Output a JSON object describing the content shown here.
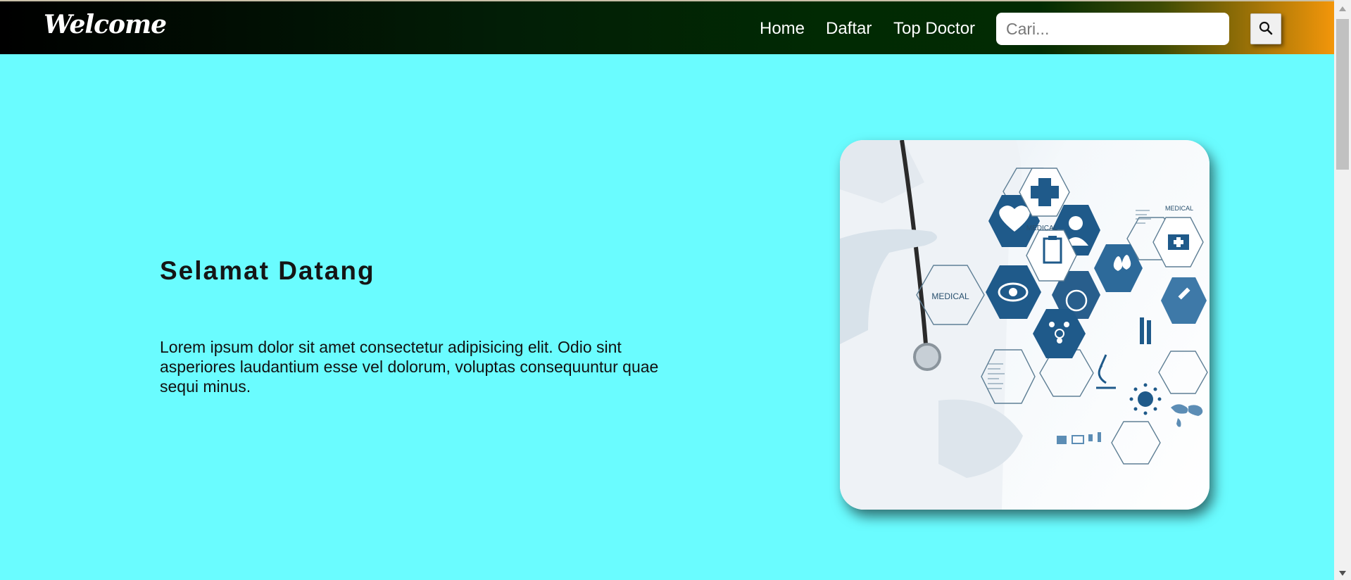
{
  "navbar": {
    "brand": "Welcome",
    "links": [
      {
        "label": "Home"
      },
      {
        "label": "Daftar"
      },
      {
        "label": "Top Doctor"
      }
    ],
    "search": {
      "placeholder": "Cari...",
      "value": "",
      "button_icon": "search-icon"
    }
  },
  "hero": {
    "title": "Selamat Datang",
    "text": "Lorem ipsum dolor sit amet consectetur adipisicing elit. Odio sint asperiores laudantium esse vel dolorum, voluptas consequuntur quae sequi minus.",
    "image": {
      "hex_labels": [
        "MEDICAL",
        "MEDICAL",
        "MEDICAL"
      ],
      "icons": [
        "heart-icon",
        "cross-icon",
        "person-icon",
        "clipboard-icon",
        "eye-icon",
        "drops-icon",
        "wheelchair-icon",
        "molecule-icon",
        "test-tubes-icon",
        "microscope-icon",
        "syringe-icon",
        "medical-bag-icon",
        "virus-icon",
        "world-map-icon"
      ]
    }
  },
  "colors": {
    "page_background": "#6afcff",
    "navbar_gradient_start": "#000000",
    "navbar_gradient_end": "#f3960a",
    "hex_blue": "#1f5a8a"
  }
}
